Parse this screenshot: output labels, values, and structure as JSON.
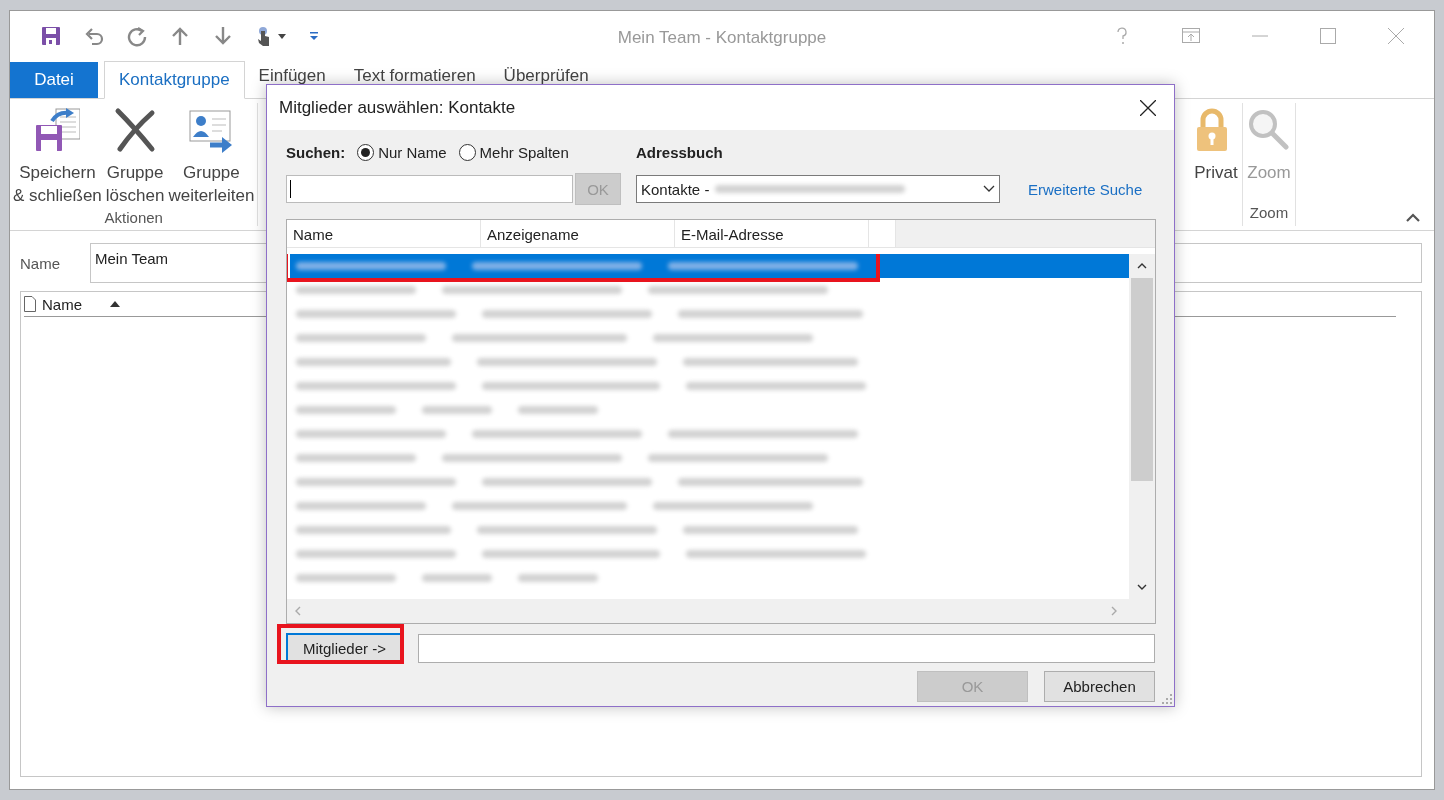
{
  "window": {
    "title": "Mein Team - Kontaktgruppe"
  },
  "ribbon_tabs": [
    {
      "label": "Datei",
      "kind": "file",
      "selected": false
    },
    {
      "label": "Kontaktgruppe",
      "kind": "tab",
      "selected": true
    },
    {
      "label": "Einfügen",
      "kind": "tab",
      "selected": false
    },
    {
      "label": "Text formatieren",
      "kind": "tab",
      "selected": false
    },
    {
      "label": "Überprüfen",
      "kind": "tab",
      "selected": false
    }
  ],
  "ribbon_groups": [
    {
      "label": "Aktionen",
      "buttons": [
        {
          "kind": "saveclose",
          "lines": [
            "Speichern",
            "& schließen"
          ],
          "disabled": false
        },
        {
          "kind": "delete",
          "lines": [
            "Gruppe",
            "löschen"
          ],
          "disabled": false
        },
        {
          "kind": "forward",
          "lines": [
            "Gruppe",
            "weiterleiten"
          ],
          "disabled": false
        }
      ]
    },
    {
      "buttons": [
        {
          "kind": "private",
          "lines": [
            "Privat"
          ],
          "disabled": false
        }
      ]
    },
    {
      "label": "Zoom",
      "buttons": [
        {
          "kind": "zoom",
          "lines": [
            "Zoom"
          ],
          "disabled": true
        }
      ]
    }
  ],
  "form": {
    "name_label": "Name",
    "name_value": "Mein Team",
    "members_columns": [
      {
        "label": "Name",
        "sort_ascending": true
      }
    ]
  },
  "dialog": {
    "title": "Mitglieder auswählen: Kontakte",
    "search_label": "Suchen:",
    "search_modes": [
      {
        "label": "Nur Name",
        "selected": true
      },
      {
        "label": "Mehr Spalten",
        "selected": false
      }
    ],
    "search_button": {
      "label": "OK",
      "disabled": true
    },
    "address_book_label": "Adressbuch",
    "address_book_value": "Kontakte -",
    "advanced_search": "Erweiterte Suche",
    "columns": [
      "Name",
      "Anzeigename",
      "E-Mail-Adresse"
    ],
    "rows": [
      {
        "selected": true,
        "highlighted": true
      },
      {
        "selected": false,
        "highlighted": false
      },
      {
        "selected": false,
        "highlighted": false
      },
      {
        "selected": false,
        "highlighted": false
      },
      {
        "selected": false,
        "highlighted": false
      },
      {
        "selected": false,
        "highlighted": false
      },
      {
        "selected": false,
        "highlighted": false
      },
      {
        "selected": false,
        "highlighted": false
      },
      {
        "selected": false,
        "highlighted": false
      },
      {
        "selected": false,
        "highlighted": false
      },
      {
        "selected": false,
        "highlighted": false
      },
      {
        "selected": false,
        "highlighted": false
      },
      {
        "selected": false,
        "highlighted": false
      },
      {
        "selected": false,
        "highlighted": false
      }
    ],
    "members_button": {
      "label": "Mitglieder ->",
      "highlighted": true
    },
    "buttons": [
      {
        "label": "OK",
        "disabled": true
      },
      {
        "label": "Abbrechen",
        "disabled": false
      }
    ]
  }
}
